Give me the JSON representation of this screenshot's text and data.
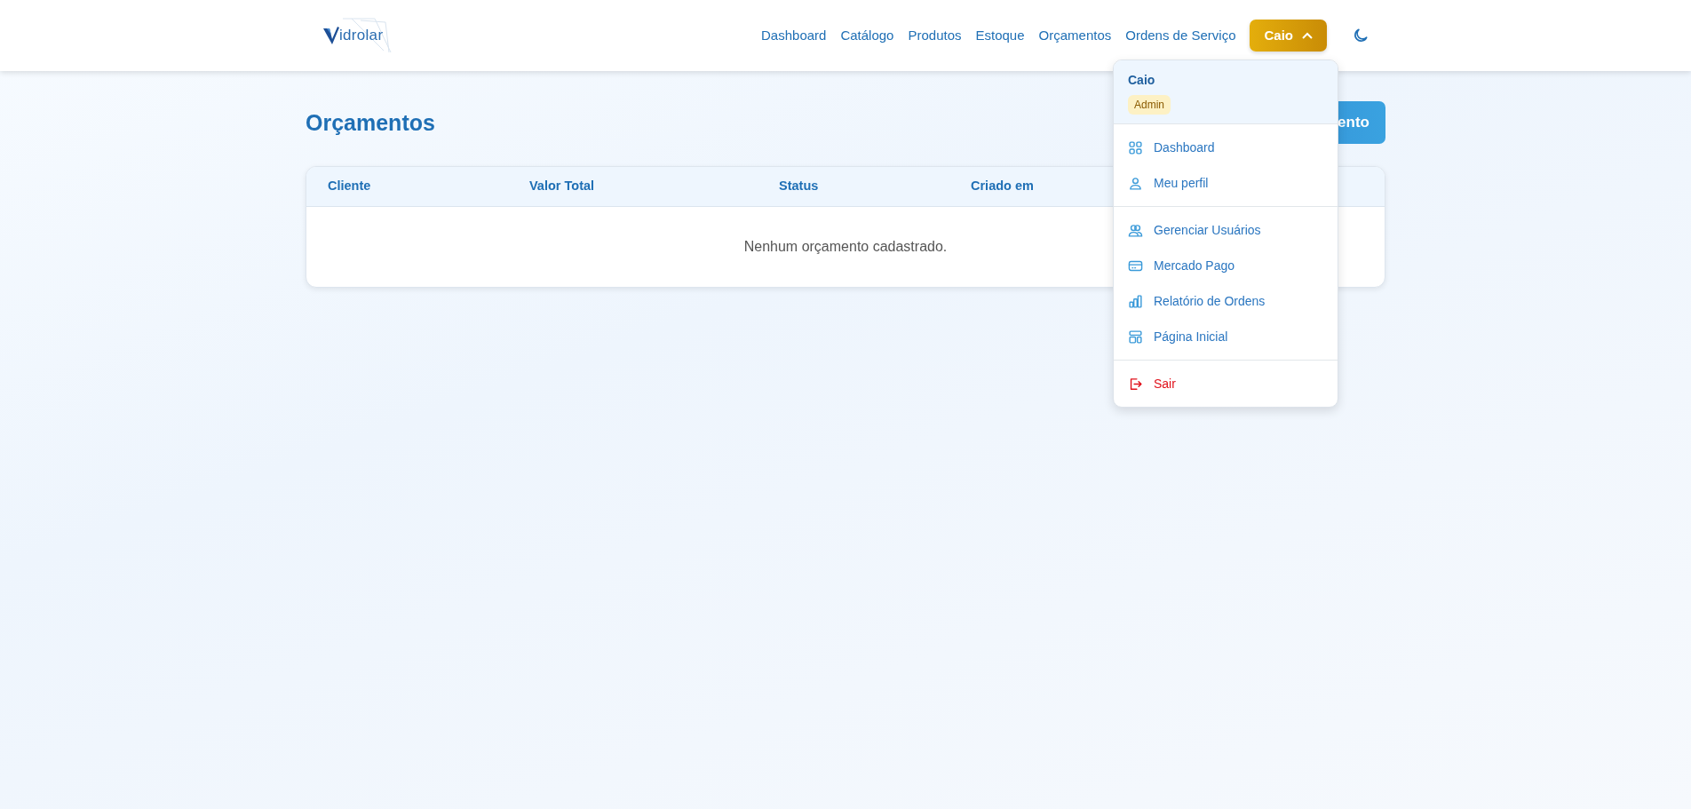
{
  "logo": {
    "text": "idrolar"
  },
  "nav": {
    "links": [
      {
        "label": "Dashboard"
      },
      {
        "label": "Catálogo"
      },
      {
        "label": "Produtos"
      },
      {
        "label": "Estoque"
      },
      {
        "label": "Orçamentos"
      },
      {
        "label": "Ordens de Serviço"
      }
    ],
    "user_button": {
      "label": "Caio",
      "expanded": true
    }
  },
  "page": {
    "title": "Orçamentos",
    "action_button": "ento"
  },
  "table": {
    "columns": [
      "Cliente",
      "Valor Total",
      "Status",
      "Criado em"
    ],
    "empty_message": "Nenhum orçamento cadastrado."
  },
  "user_menu": {
    "name": "Caio",
    "role": "Admin",
    "groups": [
      [
        {
          "label": "Dashboard",
          "kind": "grid"
        },
        {
          "label": "Meu perfil",
          "kind": "user"
        }
      ],
      [
        {
          "label": "Gerenciar Usuários",
          "kind": "users"
        },
        {
          "label": "Mercado Pago",
          "kind": "card"
        },
        {
          "label": "Relatório de Ordens",
          "kind": "chart"
        },
        {
          "label": "Página Inicial",
          "kind": "layout"
        }
      ],
      [
        {
          "label": "Sair",
          "kind": "logout"
        }
      ]
    ]
  }
}
